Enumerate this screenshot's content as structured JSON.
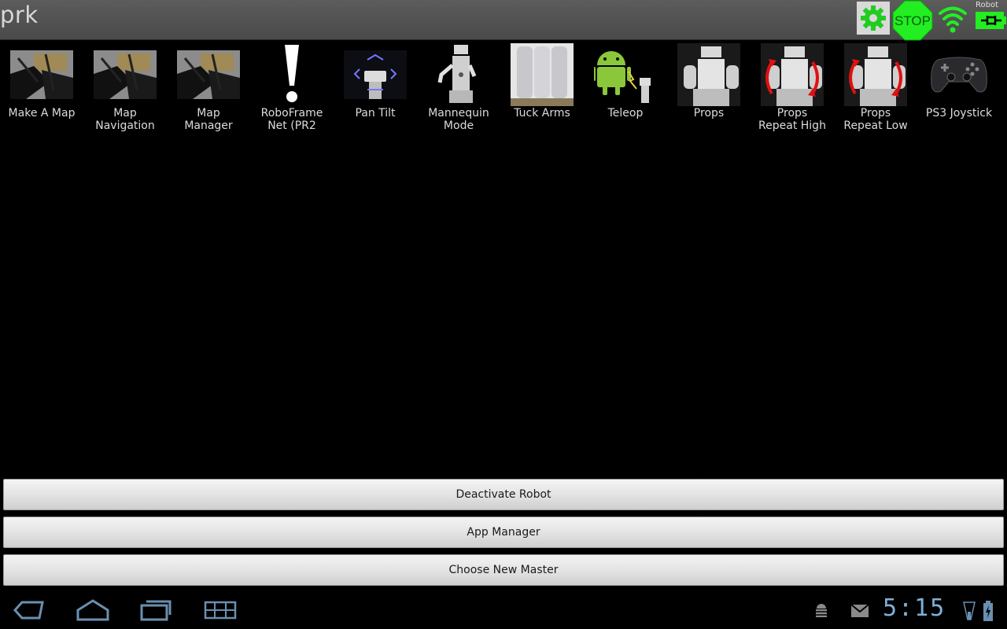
{
  "title_bar": {
    "app_title": "prk",
    "settings_icon": "gear-icon",
    "stop_label": "STOP",
    "wifi_icon": "wifi-icon",
    "robot_label": "Robot",
    "battery_icon": "robot-battery-icon",
    "accent_green": "#22dd22"
  },
  "apps": [
    {
      "label": "Make A Map",
      "icon": "map-thumbnail-icon"
    },
    {
      "label": "Map\nNavigation",
      "icon": "map-thumbnail-icon"
    },
    {
      "label": "Map\nManager",
      "icon": "map-thumbnail-icon"
    },
    {
      "label": "RoboFrame\nNet (PR2",
      "icon": "exclamation-icon"
    },
    {
      "label": "Pan Tilt",
      "icon": "pan-tilt-robot-icon"
    },
    {
      "label": "Mannequin\nMode",
      "icon": "mannequin-robot-icon"
    },
    {
      "label": "Tuck Arms",
      "icon": "tuck-arms-robot-icon"
    },
    {
      "label": "Teleop",
      "icon": "android-teleop-icon"
    },
    {
      "label": "Props",
      "icon": "props-robot-icon"
    },
    {
      "label": "Props\nRepeat High",
      "icon": "props-repeat-high-icon"
    },
    {
      "label": "Props\nRepeat Low",
      "icon": "props-repeat-low-icon"
    },
    {
      "label": "PS3 Joystick",
      "icon": "gamepad-icon"
    }
  ],
  "buttons": {
    "deactivate": "Deactivate Robot",
    "app_manager": "App Manager",
    "choose_master": "Choose New Master"
  },
  "system_bar": {
    "back_icon": "back-icon",
    "home_icon": "home-icon",
    "recent_icon": "recent-apps-icon",
    "menu_icon": "grid-menu-icon",
    "debug_icon": "android-debug-icon",
    "mail_icon": "gmail-icon",
    "clock": "5:15",
    "signal_icon": "signal-icon",
    "battery_icon": "battery-charging-icon"
  }
}
